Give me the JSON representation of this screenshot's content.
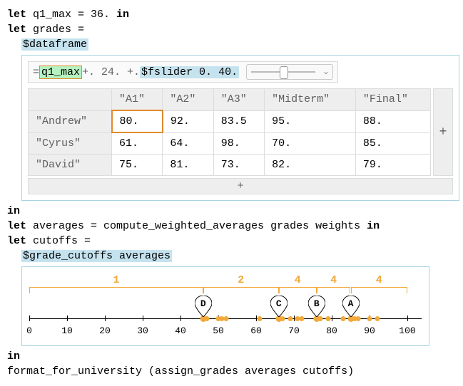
{
  "code": {
    "line1_let": "let",
    "line1_rest": " q1_max = 36. ",
    "line1_in": "in",
    "line2_let": "let",
    "line2_rest": " grades =",
    "line3_macro": "$dataframe",
    "eq_prefix": "= ",
    "eq_q1max": "q1_max",
    "eq_mid": " +. 24. +. ",
    "eq_fslider": "$fslider 0. 40.",
    "in1": "in",
    "line_avg_let": "let",
    "line_avg_rest": " averages = compute_weighted_averages grades weights ",
    "line_avg_in": "in",
    "line_cut_let": "let",
    "line_cut_rest": " cutoffs =",
    "line_cut_macro": "$grade_cutoffs averages",
    "in2": "in",
    "line_last": "format_for_university (assign_grades averages cutoffs)"
  },
  "dataframe": {
    "columns": [
      "\"A1\"",
      "\"A2\"",
      "\"A3\"",
      "\"Midterm\"",
      "\"Final\""
    ],
    "rows": [
      {
        "name": "\"Andrew\"",
        "cells": [
          "80.",
          "92.",
          "83.5",
          "95.",
          "88."
        ],
        "selected_col": 0
      },
      {
        "name": "\"Cyrus\"",
        "cells": [
          "61.",
          "64.",
          "98.",
          "70.",
          "85."
        ]
      },
      {
        "name": "\"David\"",
        "cells": [
          "75.",
          "81.",
          "73.",
          "82.",
          "79."
        ]
      }
    ],
    "plus_col": "+",
    "plus_row": "+"
  },
  "slider": {
    "position_pct": 50
  },
  "chart_data": {
    "type": "scatter",
    "title": "",
    "xlabel": "",
    "ylabel": "",
    "xlim": [
      0,
      100
    ],
    "ticks": [
      0,
      10,
      20,
      30,
      40,
      50,
      60,
      70,
      80,
      90,
      100
    ],
    "averages_points": [
      47,
      50,
      51,
      52,
      61,
      67,
      69,
      71,
      72,
      77,
      79,
      83,
      85,
      86,
      87,
      90,
      92
    ],
    "cutoffs": [
      {
        "grade": "D",
        "x": 46
      },
      {
        "grade": "C",
        "x": 66
      },
      {
        "grade": "B",
        "x": 76
      },
      {
        "grade": "A",
        "x": 85
      }
    ],
    "range_counts": [
      {
        "label": "1",
        "from": 0,
        "to": 46
      },
      {
        "label": "",
        "from": 46,
        "to": 66
      },
      {
        "label": "2",
        "from": 46,
        "to": 66
      },
      {
        "label": "4",
        "from": 66,
        "to": 76
      },
      {
        "label": "4",
        "from": 76,
        "to": 85
      },
      {
        "label": "4",
        "from": 85,
        "to": 100
      }
    ]
  }
}
